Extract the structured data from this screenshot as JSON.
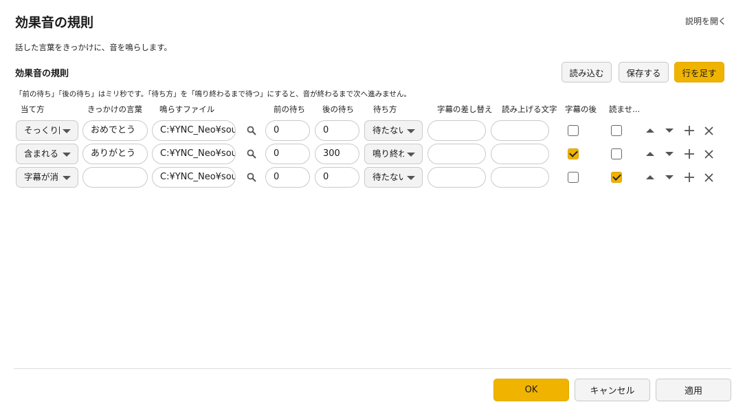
{
  "dialog": {
    "title": "効果音の規則",
    "help_link": "説明を開く",
    "description": "話した言葉をきっかけに、音を鳴らします。"
  },
  "section": {
    "title": "効果音の規則",
    "buttons": {
      "import": "読み込む",
      "save": "保存する",
      "add_row": "行を足す"
    },
    "note": "「前の待ち」「後の待ち」はミリ秒です。「待ち方」を「鳴り終わるまで待つ」にすると、音が終わるまで次へ進みません。"
  },
  "table": {
    "headers": [
      "当て方",
      "きっかけの言葉",
      "鳴らすファイル",
      "前の待ち",
      "後の待ち",
      "待ち方",
      "字幕の差し替え",
      "読み上げる文字",
      "字幕の後",
      "読ませ..."
    ],
    "rows": [
      {
        "match": "そっくり同じ",
        "trigger": "おめでとう",
        "file": "C:¥YNC_Neo¥sounds",
        "pre_wait": "0",
        "post_wait": "0",
        "wait_mode": "待たない",
        "subtitle": "",
        "read_text": "",
        "after_subtitle": false,
        "speak": false
      },
      {
        "match": "含まれる",
        "trigger": "ありがとう",
        "file": "C:¥YNC_Neo¥sounds",
        "pre_wait": "0",
        "post_wait": "300",
        "wait_mode": "鳴り終わるまで待つ",
        "subtitle": "",
        "read_text": "",
        "after_subtitle": true,
        "speak": false
      },
      {
        "match": "字幕が消えたら",
        "trigger": "",
        "file": "C:¥YNC_Neo¥sounds",
        "pre_wait": "0",
        "post_wait": "0",
        "wait_mode": "待たない",
        "subtitle": "",
        "read_text": "",
        "after_subtitle": false,
        "speak": true
      }
    ]
  },
  "footer": {
    "ok": "OK",
    "cancel": "キャンセル",
    "apply": "適用"
  },
  "colors": {
    "accent": "#f0b400",
    "border": "#c9c9c9"
  },
  "icons": [
    "search-icon",
    "move-up-icon",
    "move-down-icon",
    "add-row-icon",
    "delete-row-icon"
  ]
}
